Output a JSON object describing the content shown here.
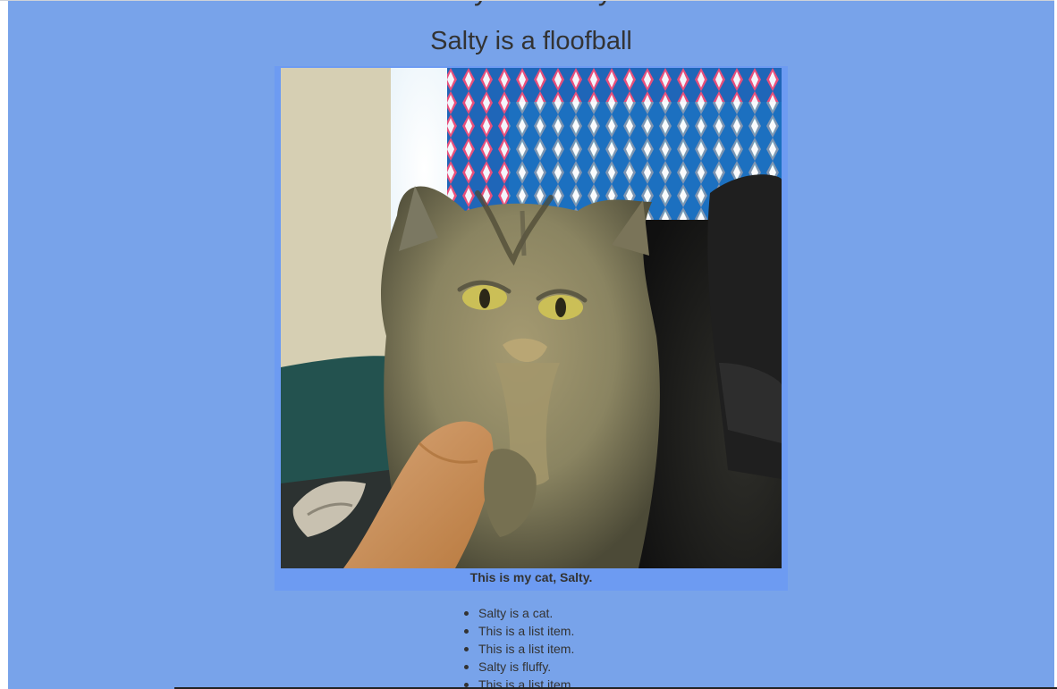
{
  "page": {
    "title": "My Cat Salty",
    "subtitle": "Salty is a floofball"
  },
  "figure": {
    "caption": "This is my cat, Salty."
  },
  "facts": [
    "Salty is a cat.",
    "This is a list item.",
    "This is a list item.",
    "Salty is fluffy.",
    "This is a list item."
  ],
  "colors": {
    "background": "#78a3ea",
    "figure_background": "#6d9bf2",
    "text": "#333333"
  }
}
